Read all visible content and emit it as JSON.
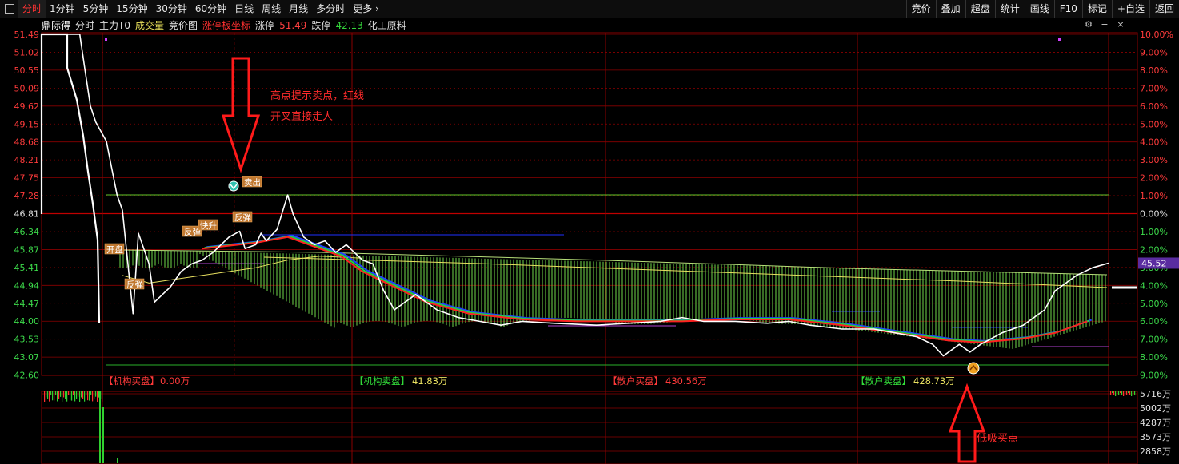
{
  "toolbar": {
    "tabs": [
      "分时",
      "1分钟",
      "5分钟",
      "15分钟",
      "30分钟",
      "60分钟",
      "日线",
      "周线",
      "月线",
      "多分时",
      "更多"
    ],
    "active_tab": "分时",
    "right_buttons": [
      "竞价",
      "叠加",
      "超盘",
      "统计",
      "画线",
      "F10",
      "标记",
      "+自选",
      "返回"
    ]
  },
  "infobar": {
    "stock_name": "鼎际得",
    "items": [
      "分时",
      "主力T0",
      "成交量",
      "竞价图",
      "涨停板坐标"
    ],
    "limit_up_label": "涨停",
    "limit_up_value": "51.49",
    "limit_down_label": "跌停",
    "limit_down_value": "42.13",
    "sector": "化工原料"
  },
  "price_axis": {
    "ticks": [
      "51.49",
      "51.02",
      "50.55",
      "50.09",
      "49.62",
      "49.15",
      "48.68",
      "48.21",
      "47.75",
      "47.28",
      "46.81",
      "46.34",
      "45.87",
      "45.41",
      "44.94",
      "44.47",
      "44.00",
      "43.53",
      "43.07",
      "42.60"
    ],
    "pct_ticks": [
      "10.00%",
      "9.00%",
      "8.00%",
      "7.00%",
      "6.00%",
      "5.00%",
      "4.00%",
      "3.00%",
      "2.00%",
      "1.00%",
      "0.00%",
      "1.00%",
      "2.00%",
      "3.00%",
      "4.00%",
      "5.00%",
      "6.00%",
      "7.00%",
      "8.00%",
      "9.00%"
    ],
    "current_price_tag": "45.52",
    "prev_close": 46.81
  },
  "volume_axis": {
    "ticks": [
      "5716万",
      "5002万",
      "4287万",
      "3573万",
      "2858万"
    ]
  },
  "chart_labels": {
    "signals": [
      "开盘",
      "反弹",
      "反弹",
      "快升",
      "反弹",
      "卖出"
    ],
    "annotation_top_line1": "高点提示卖点，红线",
    "annotation_top_line2": "开叉直接走人",
    "annotation_bottom": "低吸买点"
  },
  "flow_panel": [
    {
      "label": "【机构买盘】",
      "value": "0.00万",
      "color": "#ff3a3a"
    },
    {
      "label": "【机构卖盘】",
      "value": "41.83万",
      "color": "#33dd3a"
    },
    {
      "label": "【散户买盘】",
      "value": "430.56万",
      "color": "#ff3a3a"
    },
    {
      "label": "【散户卖盘】",
      "value": "428.73万",
      "color": "#33dd3a"
    }
  ],
  "colors": {
    "price_line": "#ffffff",
    "ma_red": "#ff2020",
    "ma_green": "#22d040",
    "ma_blue": "#2040ff",
    "avg_yellow": "#e8e060",
    "grid_red": "#8a0000",
    "accent": "#ff3333"
  },
  "chart_data": {
    "type": "line",
    "y_range": [
      42.6,
      51.49
    ],
    "prev_close": 46.81,
    "limit_up": 51.49,
    "limit_down": 42.13,
    "current": 45.52,
    "price_series": [
      [
        0.0,
        51.49
      ],
      [
        0.01,
        51.49
      ],
      [
        0.035,
        51.49
      ],
      [
        0.04,
        50.55
      ],
      [
        0.045,
        49.62
      ],
      [
        0.05,
        49.2
      ],
      [
        0.06,
        48.7
      ],
      [
        0.065,
        48.0
      ],
      [
        0.07,
        47.3
      ],
      [
        0.075,
        46.9
      ],
      [
        0.085,
        44.2
      ],
      [
        0.09,
        46.3
      ],
      [
        0.1,
        45.5
      ],
      [
        0.105,
        44.5
      ],
      [
        0.12,
        44.9
      ],
      [
        0.13,
        45.3
      ],
      [
        0.14,
        45.5
      ],
      [
        0.15,
        45.6
      ],
      [
        0.16,
        45.8
      ],
      [
        0.175,
        46.2
      ],
      [
        0.185,
        46.35
      ],
      [
        0.19,
        45.9
      ],
      [
        0.2,
        46.0
      ],
      [
        0.205,
        46.3
      ],
      [
        0.21,
        46.1
      ],
      [
        0.22,
        46.4
      ],
      [
        0.23,
        47.3
      ],
      [
        0.235,
        46.8
      ],
      [
        0.245,
        46.2
      ],
      [
        0.255,
        46.0
      ],
      [
        0.265,
        46.1
      ],
      [
        0.275,
        45.8
      ],
      [
        0.285,
        46.0
      ],
      [
        0.3,
        45.6
      ],
      [
        0.31,
        45.5
      ],
      [
        0.32,
        44.8
      ],
      [
        0.33,
        44.3
      ],
      [
        0.34,
        44.5
      ],
      [
        0.35,
        44.7
      ],
      [
        0.37,
        44.3
      ],
      [
        0.39,
        44.1
      ],
      [
        0.41,
        44.0
      ],
      [
        0.43,
        43.9
      ],
      [
        0.45,
        44.0
      ],
      [
        0.48,
        43.95
      ],
      [
        0.52,
        43.9
      ],
      [
        0.55,
        43.95
      ],
      [
        0.58,
        44.0
      ],
      [
        0.6,
        44.1
      ],
      [
        0.62,
        44.0
      ],
      [
        0.65,
        44.0
      ],
      [
        0.68,
        43.95
      ],
      [
        0.7,
        44.0
      ],
      [
        0.72,
        43.9
      ],
      [
        0.75,
        43.8
      ],
      [
        0.78,
        43.8
      ],
      [
        0.8,
        43.7
      ],
      [
        0.82,
        43.6
      ],
      [
        0.835,
        43.4
      ],
      [
        0.845,
        43.1
      ],
      [
        0.86,
        43.4
      ],
      [
        0.87,
        43.2
      ],
      [
        0.88,
        43.4
      ],
      [
        0.9,
        43.7
      ],
      [
        0.92,
        43.9
      ],
      [
        0.94,
        44.3
      ],
      [
        0.95,
        44.8
      ],
      [
        0.96,
        45.0
      ],
      [
        0.97,
        45.2
      ],
      [
        0.985,
        45.4
      ],
      [
        1.0,
        45.52
      ]
    ],
    "red_ma": [
      [
        0.15,
        45.9
      ],
      [
        0.2,
        46.05
      ],
      [
        0.23,
        46.2
      ],
      [
        0.25,
        46.0
      ],
      [
        0.28,
        45.7
      ],
      [
        0.3,
        45.3
      ],
      [
        0.33,
        44.9
      ],
      [
        0.36,
        44.5
      ],
      [
        0.4,
        44.2
      ],
      [
        0.45,
        44.05
      ],
      [
        0.5,
        44.0
      ],
      [
        0.55,
        44.0
      ],
      [
        0.6,
        44.0
      ],
      [
        0.65,
        44.05
      ],
      [
        0.7,
        44.05
      ],
      [
        0.75,
        43.9
      ],
      [
        0.8,
        43.7
      ],
      [
        0.85,
        43.5
      ],
      [
        0.88,
        43.45
      ],
      [
        0.92,
        43.55
      ],
      [
        0.95,
        43.7
      ],
      [
        0.98,
        44.0
      ]
    ],
    "yellow_avg": [
      [
        0.075,
        45.2
      ],
      [
        0.1,
        45.0
      ],
      [
        0.15,
        45.2
      ],
      [
        0.2,
        45.4
      ],
      [
        0.23,
        45.6
      ],
      [
        0.26,
        45.7
      ],
      [
        0.3,
        45.65
      ]
    ],
    "volume": [
      5716,
      5002,
      4287,
      3573,
      2858
    ]
  }
}
